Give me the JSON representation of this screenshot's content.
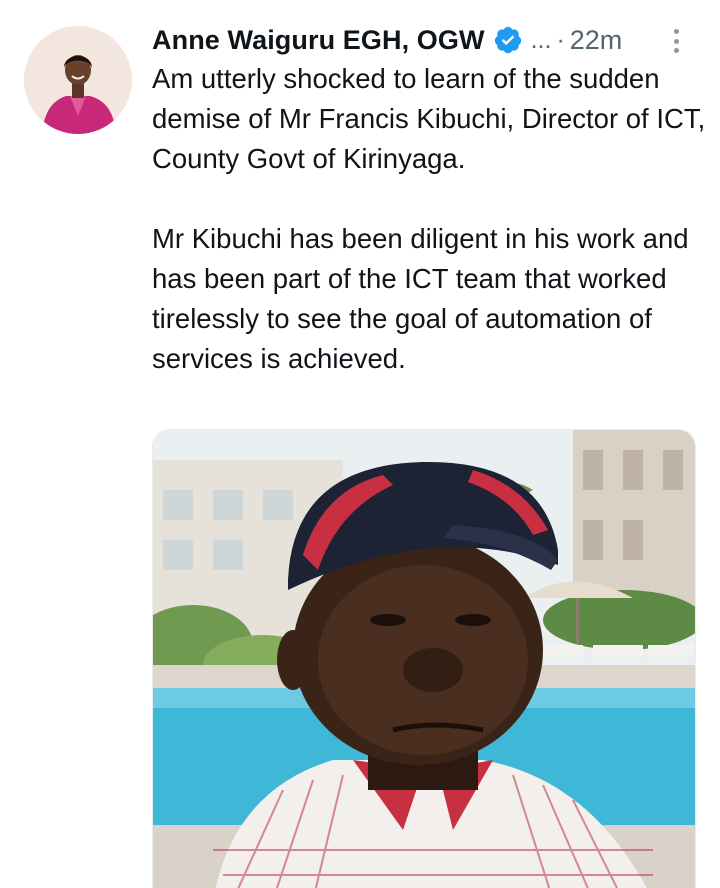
{
  "tweet": {
    "author_name": "Anne Waiguru EGH, OGW",
    "handle_truncated": "...",
    "separator": "·",
    "time": "22m",
    "paragraphs": [
      "Am utterly shocked to learn of the sudden demise of Mr Francis Kibuchi, Director of ICT, County Govt of Kirinyaga.",
      "Mr Kibuchi has been diligent in his work and has been part of the ICT team that worked tirelessly to see the goal of automation of services is achieved."
    ]
  },
  "icons": {
    "verified": "verified-badge-icon",
    "more": "more-vertical-icon"
  },
  "colors": {
    "text": "#0f1419",
    "secondary": "#536471",
    "verified": "#1d9bf0"
  }
}
